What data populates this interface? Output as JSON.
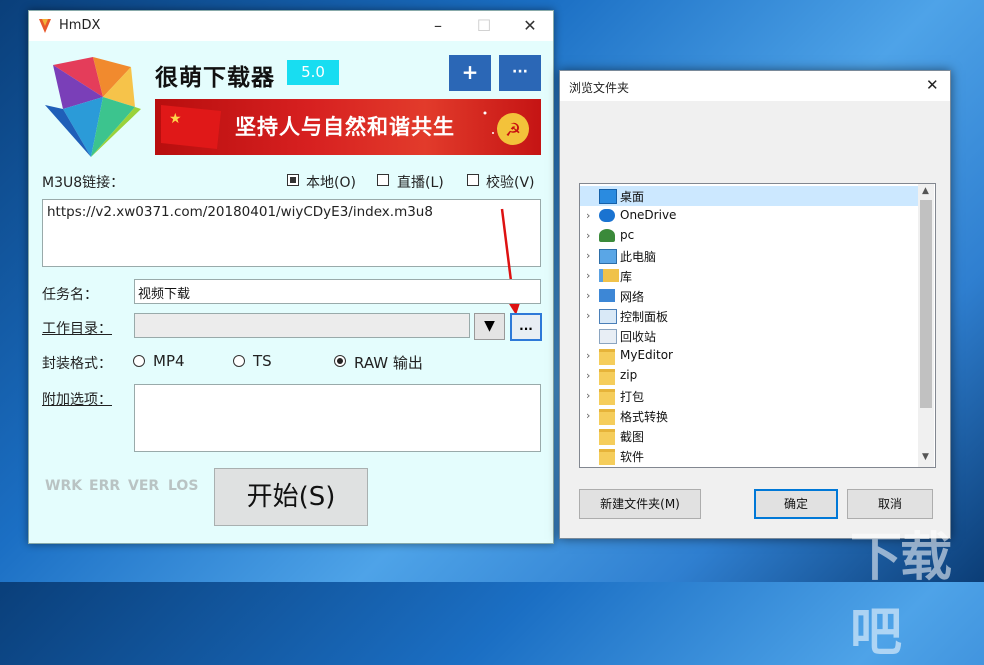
{
  "hmdx": {
    "title": "HmDX",
    "app_name": "很萌下载器",
    "version": "5.0",
    "add_label": "+",
    "more_label": "···",
    "banner_text": "坚持人与自然和谐共生",
    "m3u8_label": "M3U8链接：",
    "opt_local": "本地(O)",
    "opt_live": "直播(L)",
    "opt_verify": "校验(V)",
    "url_value": "https://v2.xw0371.com/20180401/wiyCDyE3/index.m3u8",
    "task_label": "任务名：",
    "task_value": "视频下载",
    "workdir_label": "工作目录：",
    "workdir_value": "",
    "dropdown_glyph": "▼",
    "browse_label": "...",
    "format_label": "封装格式：",
    "fmt_mp4": "MP4",
    "fmt_ts": "TS",
    "fmt_raw": "RAW 输出",
    "extra_label": "附加选项：",
    "status": [
      "WRK",
      "ERR",
      "VER",
      "LOS"
    ],
    "start_label": "开始(S)"
  },
  "dialog": {
    "title": "浏览文件夹",
    "close": "✕",
    "tree": [
      {
        "label": "桌面",
        "icon": "desktop-icon",
        "arrow": "",
        "selected": true
      },
      {
        "label": "OneDrive",
        "icon": "cloud-icon",
        "arrow": "›"
      },
      {
        "label": "pc",
        "icon": "user-icon",
        "arrow": "›"
      },
      {
        "label": "此电脑",
        "icon": "computer-icon",
        "arrow": "›"
      },
      {
        "label": "库",
        "icon": "library-icon",
        "arrow": "›"
      },
      {
        "label": "网络",
        "icon": "network-icon",
        "arrow": "›"
      },
      {
        "label": "控制面板",
        "icon": "control-panel-icon",
        "arrow": "›"
      },
      {
        "label": "回收站",
        "icon": "recycle-bin-icon",
        "arrow": ""
      },
      {
        "label": "MyEditor",
        "icon": "folder-icon",
        "arrow": "›"
      },
      {
        "label": "zip",
        "icon": "folder-icon",
        "arrow": "›"
      },
      {
        "label": "打包",
        "icon": "folder-icon",
        "arrow": "›"
      },
      {
        "label": "格式转换",
        "icon": "folder-icon",
        "arrow": "›"
      },
      {
        "label": "截图",
        "icon": "folder-icon",
        "arrow": ""
      },
      {
        "label": "软件",
        "icon": "folder-icon",
        "arrow": ""
      }
    ],
    "new_folder": "新建文件夹(M)",
    "ok": "确定",
    "cancel": "取消"
  },
  "colors": {
    "window_bg": "#e4fdfd",
    "version_badge": "#18ddf1",
    "blue_button": "#2b67b6",
    "banner": "#d72020",
    "selection": "#cce8ff"
  },
  "watermark": "下载吧"
}
